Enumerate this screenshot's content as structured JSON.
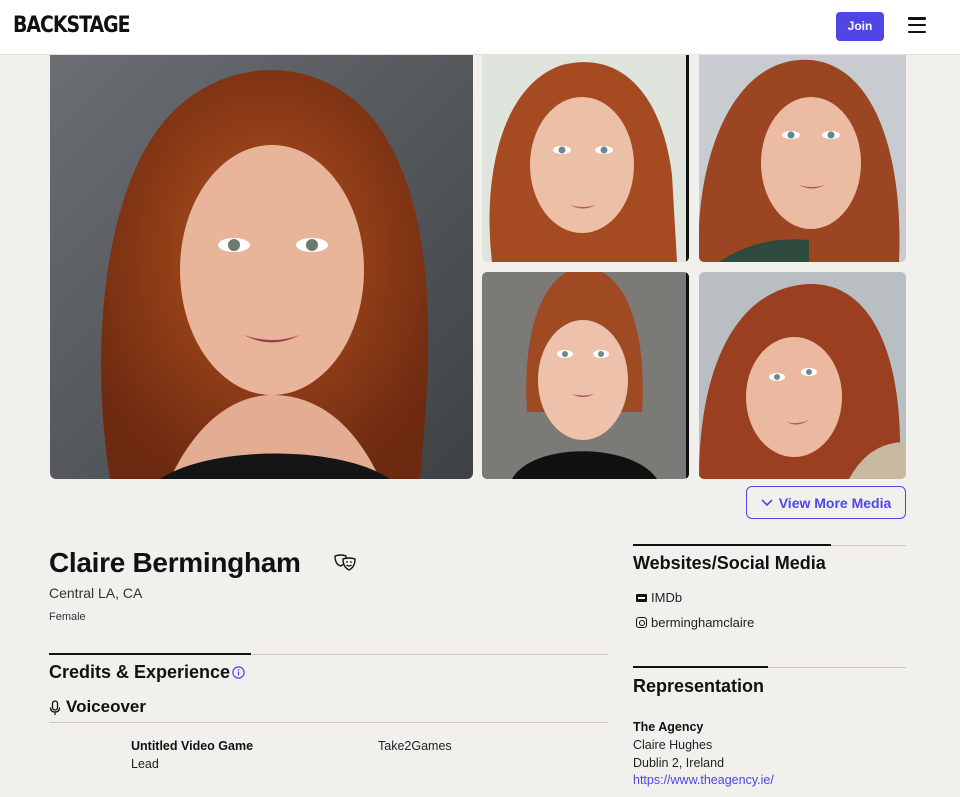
{
  "header": {
    "logo": "BACKSTAGE",
    "join_label": "Join"
  },
  "gallery": {
    "view_more_label": "View More Media"
  },
  "profile": {
    "name": "Claire Bermingham",
    "location": "Central LA, CA",
    "gender": "Female"
  },
  "credits": {
    "title": "Credits & Experience",
    "category": "Voiceover",
    "items": [
      {
        "title": "Untitled Video Game",
        "role": "Lead",
        "company": "Take2Games"
      }
    ]
  },
  "social": {
    "title": "Websites/Social Media",
    "links": [
      {
        "icon": "imdb-icon",
        "label": "IMDb"
      },
      {
        "icon": "instagram-icon",
        "label": "berminghamclaire"
      }
    ]
  },
  "representation": {
    "title": "Representation",
    "agency": "The Agency",
    "agent": "Claire Hughes",
    "address": "Dublin 2, Ireland",
    "url": "https://www.theagency.ie/"
  },
  "colors": {
    "accent": "#4f46e5",
    "page_bg": "#f1f0ec"
  }
}
